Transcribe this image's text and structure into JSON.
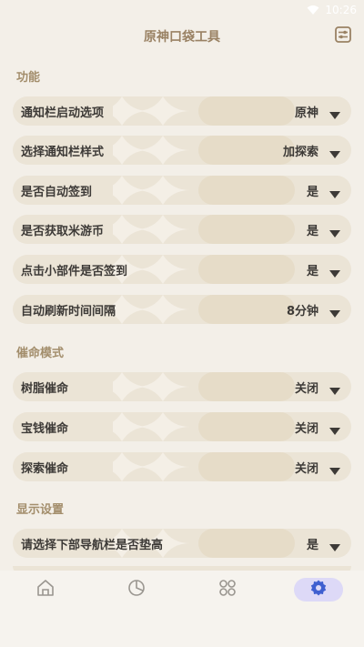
{
  "status_bar": {
    "time": "10:26"
  },
  "app_bar": {
    "title": "原神口袋工具",
    "filter_icon": "tune-icon"
  },
  "sections": [
    {
      "title": "功能",
      "items": [
        {
          "label": "通知栏启动选项",
          "value": "原神"
        },
        {
          "label": "选择通知栏样式",
          "value": "加探索"
        },
        {
          "label": "是否自动签到",
          "value": "是"
        },
        {
          "label": "是否获取米游币",
          "value": "是"
        },
        {
          "label": "点击小部件是否签到",
          "value": "是"
        },
        {
          "label": "自动刷新时间间隔",
          "value": "8分钟"
        }
      ]
    },
    {
      "title": "催命模式",
      "items": [
        {
          "label": "树脂催命",
          "value": "关闭"
        },
        {
          "label": "宝钱催命",
          "value": "关闭"
        },
        {
          "label": "探索催命",
          "value": "关闭"
        }
      ]
    },
    {
      "title": "显示设置",
      "items": [
        {
          "label": "请选择下部导航栏是否垫高",
          "value": "是"
        }
      ]
    }
  ],
  "bottom_nav": {
    "items": [
      {
        "icon": "home-icon",
        "active": false
      },
      {
        "icon": "pie-chart-icon",
        "active": false
      },
      {
        "icon": "grid-icon",
        "active": false
      },
      {
        "icon": "gear-icon",
        "active": true
      }
    ]
  },
  "colors": {
    "background": "#f3efe8",
    "row_background": "#ebe4d6",
    "section_title": "#a38e6c",
    "text": "#3d3a37",
    "nav_active_pill": "#ddd9f7",
    "nav_active_icon": "#3f5fd0",
    "nav_inactive_icon": "#9a9690"
  }
}
